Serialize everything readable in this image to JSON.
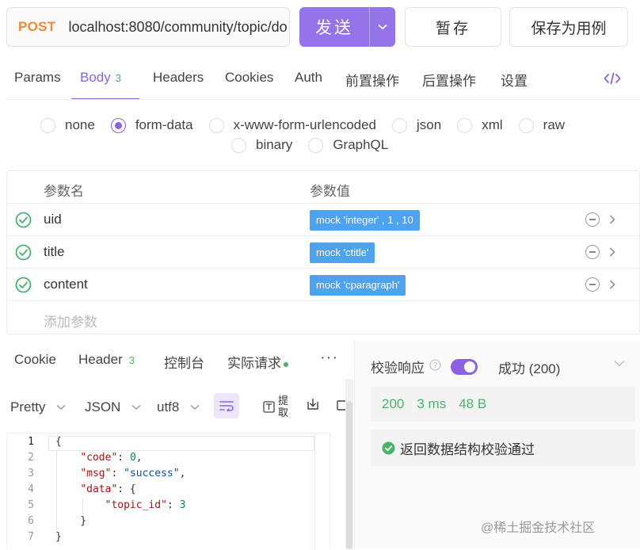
{
  "request": {
    "method": "POST",
    "url": "localhost:8080/community/topic/do",
    "send_label": "发送",
    "save_label": "暂存",
    "save_example_label": "保存为用例",
    "method_color": "#f0883a",
    "accent_color": "#9573e8"
  },
  "tabs": [
    {
      "label": "Params"
    },
    {
      "label": "Body",
      "count": "3",
      "active": true
    },
    {
      "label": "Headers"
    },
    {
      "label": "Cookies"
    },
    {
      "label": "Auth"
    },
    {
      "label": "前置操作"
    },
    {
      "label": "后置操作"
    },
    {
      "label": "设置"
    }
  ],
  "body_types": [
    {
      "label": "none"
    },
    {
      "label": "form-data",
      "checked": true
    },
    {
      "label": "x-www-form-urlencoded"
    },
    {
      "label": "json"
    },
    {
      "label": "xml"
    },
    {
      "label": "raw"
    },
    {
      "label": "binary"
    },
    {
      "label": "GraphQL"
    }
  ],
  "params": {
    "header_name": "参数名",
    "header_value": "参数值",
    "rows": [
      {
        "name": "uid",
        "value": "mock 'integer' , 1 , 10"
      },
      {
        "name": "title",
        "value": "mock 'ctitle'"
      },
      {
        "name": "content",
        "value": "mock 'cparagraph'"
      }
    ],
    "add_placeholder": "添加参数"
  },
  "response_tabs": [
    {
      "label": "Cookie"
    },
    {
      "label": "Header",
      "count": "3"
    },
    {
      "label": "控制台"
    },
    {
      "label": "实际请求",
      "dot": true
    },
    {
      "label": "···"
    }
  ],
  "format_bar": {
    "pretty": "Pretty",
    "format": "JSON",
    "encoding": "utf8",
    "extract_label": "提取"
  },
  "response_code": {
    "line_numbers": [
      "1",
      "2",
      "3",
      "4",
      "5",
      "6",
      "7"
    ],
    "lines": [
      "{",
      "    \"code\": 0,",
      "    \"msg\": \"success\",",
      "    \"data\": {",
      "        \"topic_id\": 3",
      "    }",
      "}"
    ]
  },
  "verify": {
    "label": "校验响应",
    "enabled": true,
    "status_option": "成功 (200)",
    "metrics": {
      "status": "200",
      "time": "3 ms",
      "size": "48 B"
    },
    "result_text": "返回数据结构校验通过",
    "success_color": "#49b36b"
  },
  "watermark": "@稀土掘金技术社区"
}
